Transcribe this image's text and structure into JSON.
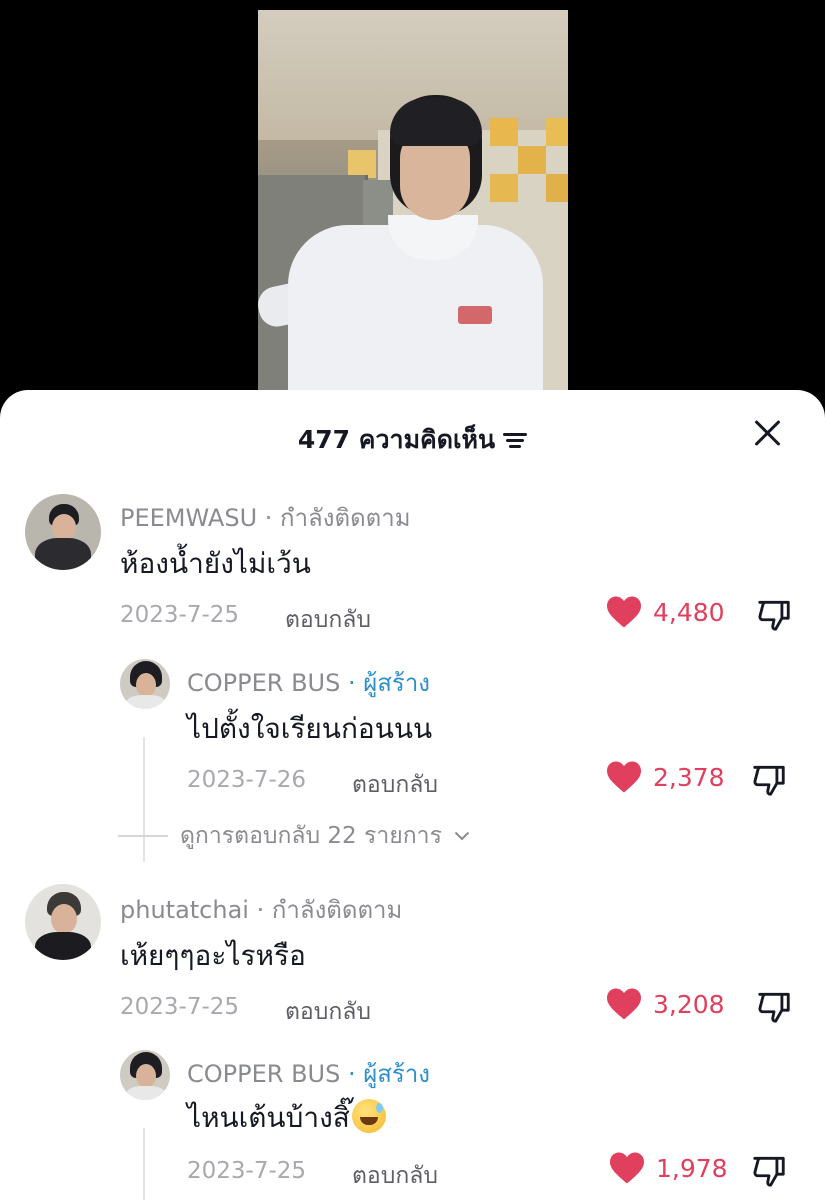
{
  "header": {
    "comment_count_title": "477 ความคิดเห็น"
  },
  "icons": {
    "filter": "filter-icon",
    "close": "close-icon",
    "like": "heart-icon",
    "dislike": "dislike-icon",
    "chevron": "chevron-down-icon"
  },
  "colors": {
    "like_red": "#e0405d",
    "creator_blue": "#2f8fc9",
    "muted_gray": "#8a8b91"
  },
  "comments": [
    {
      "username": "PEEMWASU",
      "status": " · กำลังติดตาม",
      "text": "ห้องน้ำยังไม่เว้น",
      "date": "2023-7-25",
      "reply_label": "ตอบกลับ",
      "likes": "4,480"
    },
    {
      "username": "COPPER BUS",
      "status": " · ผู้สร้าง",
      "text": "ไปตั้งใจเรียนก่อนนน",
      "date": "2023-7-26",
      "reply_label": "ตอบกลับ",
      "likes": "2,378"
    },
    {
      "username": "phutatchai",
      "status": " · กำลังติดตาม",
      "text": "เห้ยๆๆอะไรหรือ",
      "date": "2023-7-25",
      "reply_label": "ตอบกลับ",
      "likes": "3,208"
    },
    {
      "username": "COPPER BUS",
      "status": " · ผู้สร้าง",
      "text": "ไหนเต้นบ้างสิ๊",
      "emoji": "sweat-smile-emoji",
      "date": "2023-7-25",
      "reply_label": "ตอบกลับ",
      "likes": "1,978"
    }
  ],
  "view_replies": "ดูการตอบกลับ 22 รายการ"
}
